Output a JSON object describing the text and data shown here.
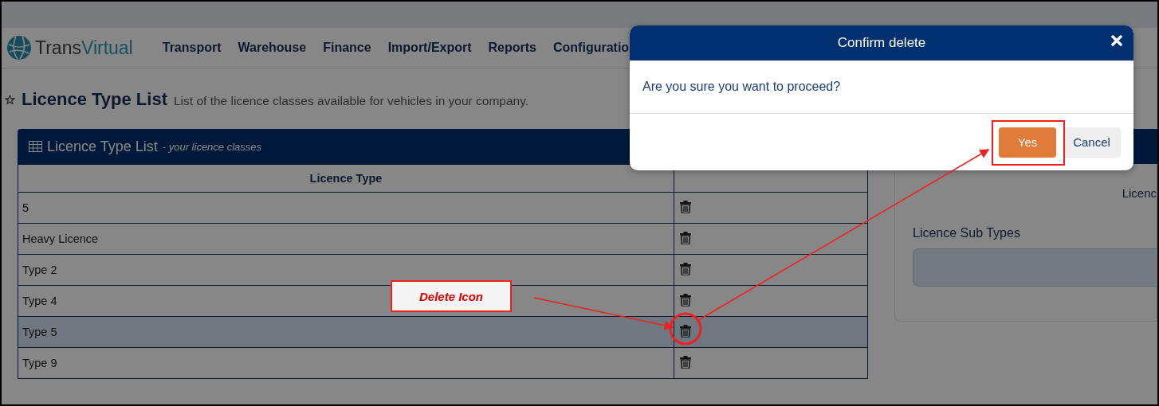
{
  "logo": {
    "first": "Trans",
    "second": "Virtual"
  },
  "nav": [
    "Transport",
    "Warehouse",
    "Finance",
    "Import/Export",
    "Reports",
    "Configuratio"
  ],
  "page": {
    "title": "Licence Type List",
    "subtitle": "List of the licence classes available for vehicles in your company."
  },
  "panel": {
    "title": "Licence Type List",
    "subtitle": "- your licence classes"
  },
  "table": {
    "columns": [
      "Licence Type"
    ],
    "rows": [
      {
        "name": "5",
        "selected": false
      },
      {
        "name": "Heavy Licence",
        "selected": false
      },
      {
        "name": "Type 2",
        "selected": false
      },
      {
        "name": "Type 4",
        "selected": false
      },
      {
        "name": "Type 5",
        "selected": true
      },
      {
        "name": "Type 9",
        "selected": false
      }
    ]
  },
  "side": {
    "cut_label": "Licenc",
    "sub_types_label": "Licence Sub Types"
  },
  "dialog": {
    "title": "Confirm delete",
    "message": "Are you sure you want to proceed?",
    "buttons": [
      {
        "label": "Yes",
        "kind": "primary"
      },
      {
        "label": "Cancel",
        "kind": "secondary"
      }
    ]
  },
  "annotation": {
    "label": "Delete Icon"
  }
}
